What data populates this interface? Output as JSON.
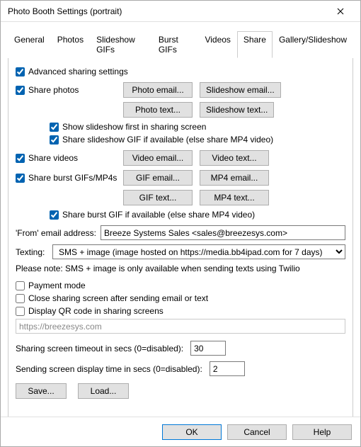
{
  "window": {
    "title": "Photo Booth Settings (portrait)"
  },
  "tabs": {
    "general": "General",
    "photos": "Photos",
    "slideshow_gifs": "Slideshow GIFs",
    "burst_gifs": "Burst GIFs",
    "videos": "Videos",
    "share": "Share",
    "gallery": "Gallery/Slideshow"
  },
  "share": {
    "advanced": "Advanced sharing settings",
    "share_photos": "Share photos",
    "photo_email_btn": "Photo email...",
    "slideshow_email_btn": "Slideshow email...",
    "photo_text_btn": "Photo text...",
    "slideshow_text_btn": "Slideshow text...",
    "show_slideshow_first": "Show slideshow first in sharing screen",
    "share_slideshow_gif": "Share slideshow GIF if available (else share MP4 video)",
    "share_videos": "Share videos",
    "video_email_btn": "Video email...",
    "video_text_btn": "Video text...",
    "share_burst": "Share burst GIFs/MP4s",
    "gif_email_btn": "GIF email...",
    "mp4_email_btn": "MP4 email...",
    "gif_text_btn": "GIF text...",
    "mp4_text_btn": "MP4 text...",
    "share_burst_gif": "Share burst GIF if available (else share MP4 video)",
    "from_label": "'From' email address:",
    "from_value": "Breeze Systems Sales <sales@breezesys.com>",
    "texting_label": "Texting:",
    "texting_value": "SMS + image (image hosted on https://media.bb4ipad.com for 7 days)",
    "note": "Please note: SMS + image is only available when sending texts using Twilio",
    "payment_mode": "Payment mode",
    "close_after_send": "Close sharing screen after sending email or text",
    "display_qr": "Display QR code in sharing screens",
    "qr_url": "https://breezesys.com",
    "sharing_timeout_label": "Sharing screen timeout in secs (0=disabled):",
    "sharing_timeout_value": "30",
    "sending_time_label": "Sending screen display time in secs (0=disabled):",
    "sending_time_value": "2",
    "save_btn": "Save...",
    "load_btn": "Load..."
  },
  "footer": {
    "ok": "OK",
    "cancel": "Cancel",
    "help": "Help"
  }
}
